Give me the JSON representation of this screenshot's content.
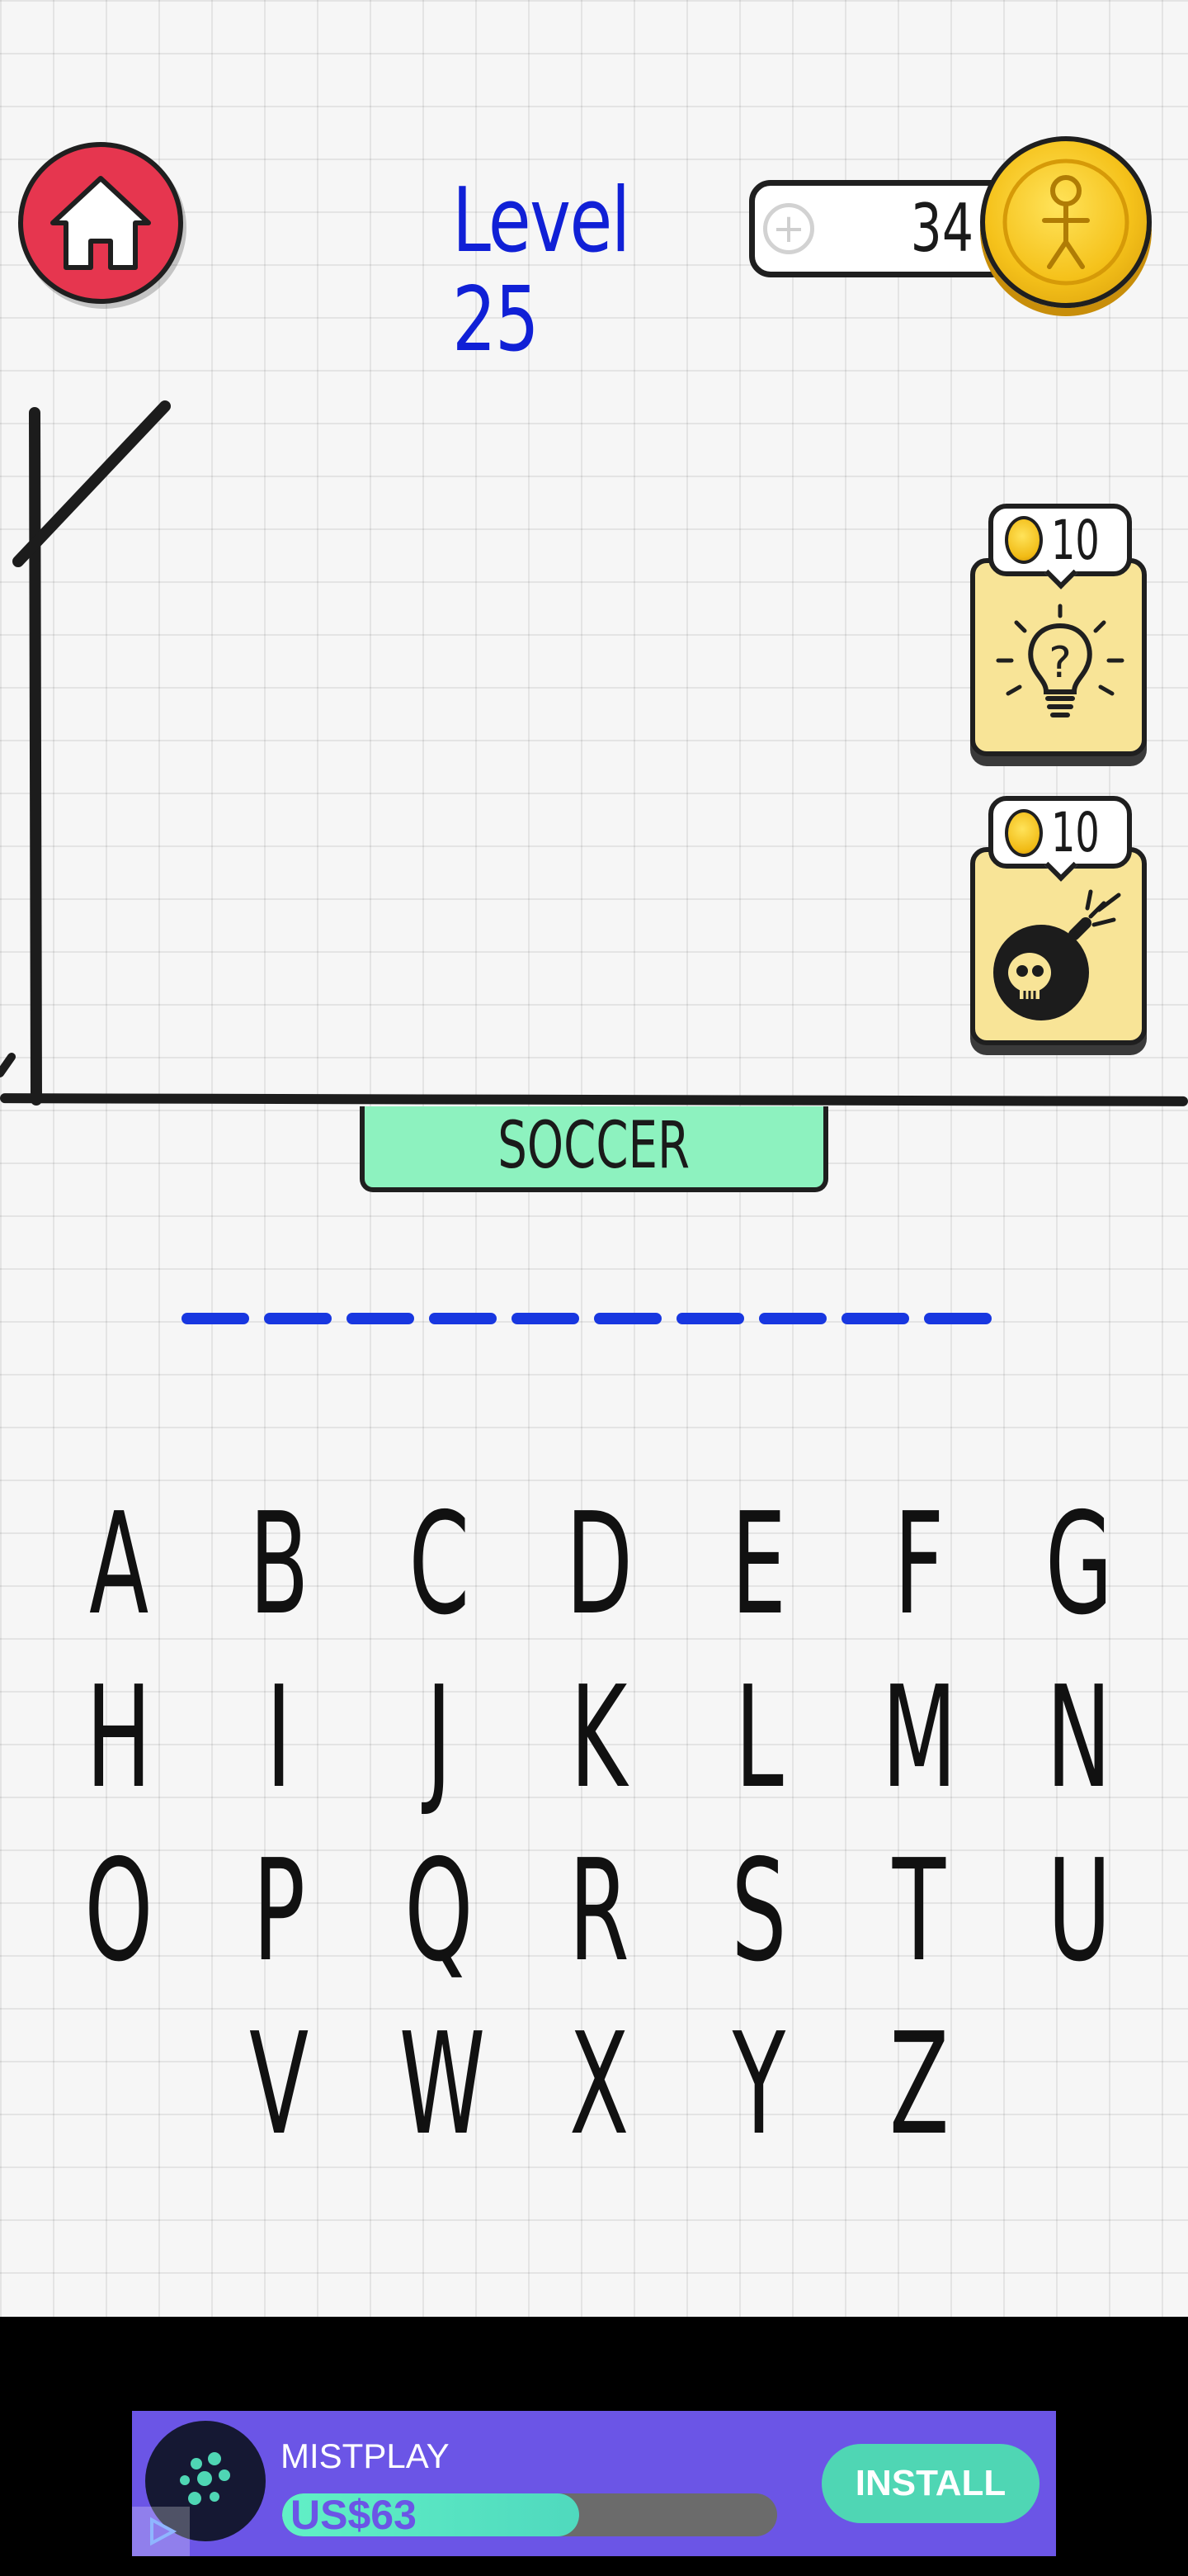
{
  "header": {
    "level_label": "Level 25",
    "coins": "34",
    "add_coins_symbol": "+"
  },
  "hints": [
    {
      "name": "reveal-letter-hint",
      "cost": "10",
      "icon": "lightbulb-question-icon"
    },
    {
      "name": "remove-letters-hint",
      "cost": "10",
      "icon": "skull-bomb-icon"
    }
  ],
  "category": "SOCCER",
  "word": {
    "letters_count": 10
  },
  "keyboard": {
    "rows": [
      [
        "A",
        "B",
        "C",
        "D",
        "E",
        "F",
        "G"
      ],
      [
        "H",
        "I",
        "J",
        "K",
        "L",
        "M",
        "N"
      ],
      [
        "O",
        "P",
        "Q",
        "R",
        "S",
        "T",
        "U"
      ],
      [
        "V",
        "W",
        "X",
        "Y",
        "Z"
      ]
    ]
  },
  "ad": {
    "app_name": "MISTPLAY",
    "price": "US$63",
    "progress": 0.6,
    "install_label": "INSTALL"
  },
  "colors": {
    "level_text": "#1020d6",
    "home_button": "#e6364f",
    "category_tag": "#8df2bf",
    "blank": "#1837e0",
    "hint_card": "#f8e497",
    "ad_background": "#6b55e6",
    "install_button": "#4fd6b4"
  }
}
